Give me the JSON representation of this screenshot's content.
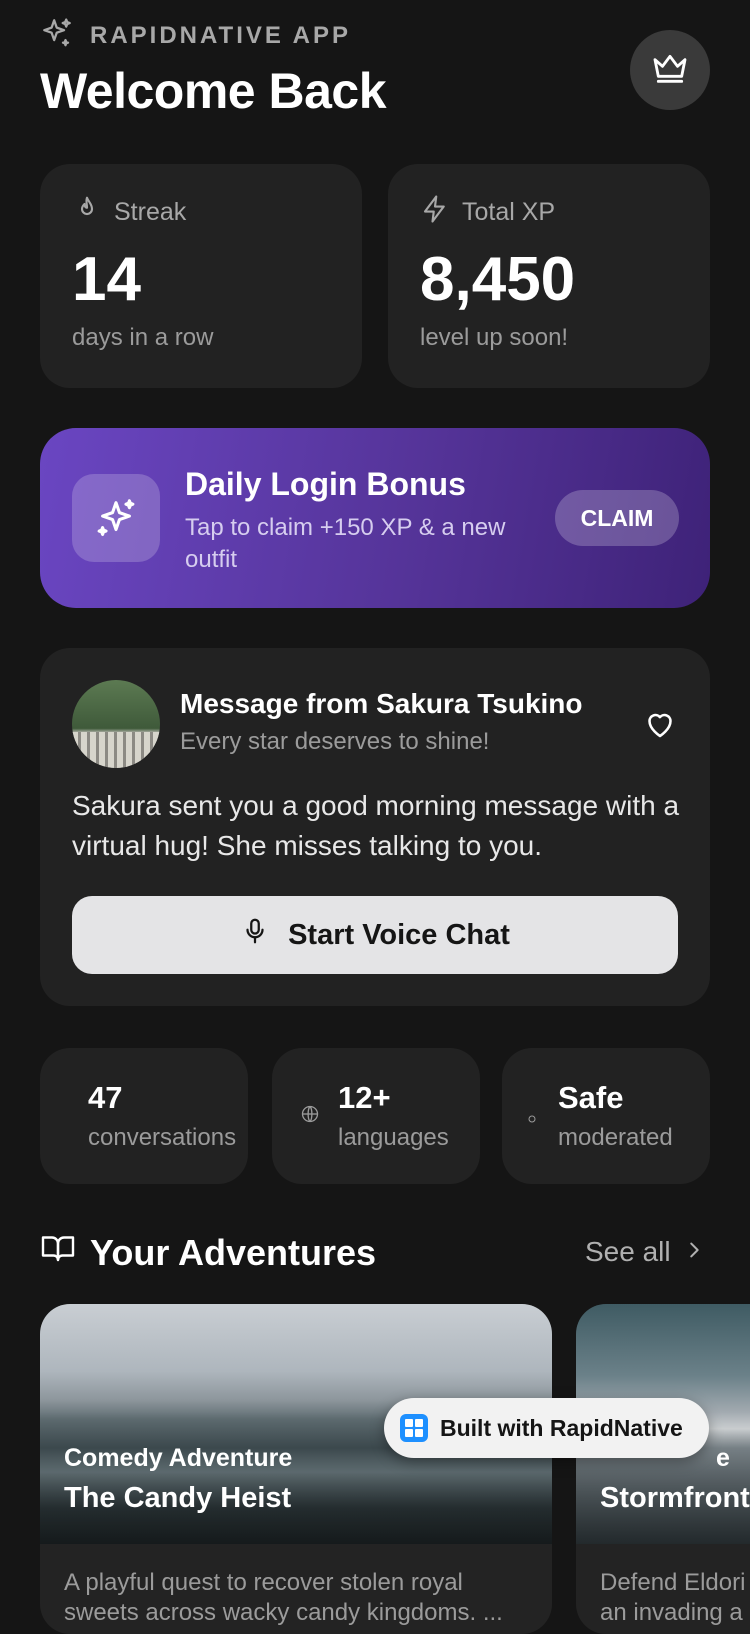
{
  "header": {
    "brand": "RAPIDNATIVE APP",
    "title": "Welcome Back"
  },
  "stats": {
    "streak": {
      "label": "Streak",
      "value": "14",
      "sub": "days in a row"
    },
    "xp": {
      "label": "Total XP",
      "value": "8,450",
      "sub": "level up soon!"
    }
  },
  "bonus": {
    "title": "Daily Login Bonus",
    "subtitle": "Tap to claim +150 XP & a new outfit",
    "button": "CLAIM"
  },
  "message": {
    "title": "Message from Sakura Tsukino",
    "subtitle": "Every star deserves to shine!",
    "body": "Sakura sent you a good morning message with a virtual hug! She misses talking to you.",
    "button": "Start Voice Chat"
  },
  "mini_stats": [
    {
      "value": "47",
      "label": "conversations"
    },
    {
      "value": "12+",
      "label": "languages"
    },
    {
      "value": "Safe",
      "label": "moderated"
    }
  ],
  "adventures": {
    "heading": "Your Adventures",
    "see_all": "See all",
    "items": [
      {
        "category": "Comedy Adventure",
        "title": "The Candy Heist",
        "description": "A playful quest to recover stolen royal sweets across wacky candy kingdoms. ..."
      },
      {
        "category": "e",
        "title": "Stormfront",
        "description": "Defend Eldori an invading a"
      }
    ]
  },
  "badge": {
    "label": "Built with RapidNative"
  },
  "colors": {
    "background": "#151515",
    "card": "#222222",
    "accent": "#6a46c2"
  }
}
